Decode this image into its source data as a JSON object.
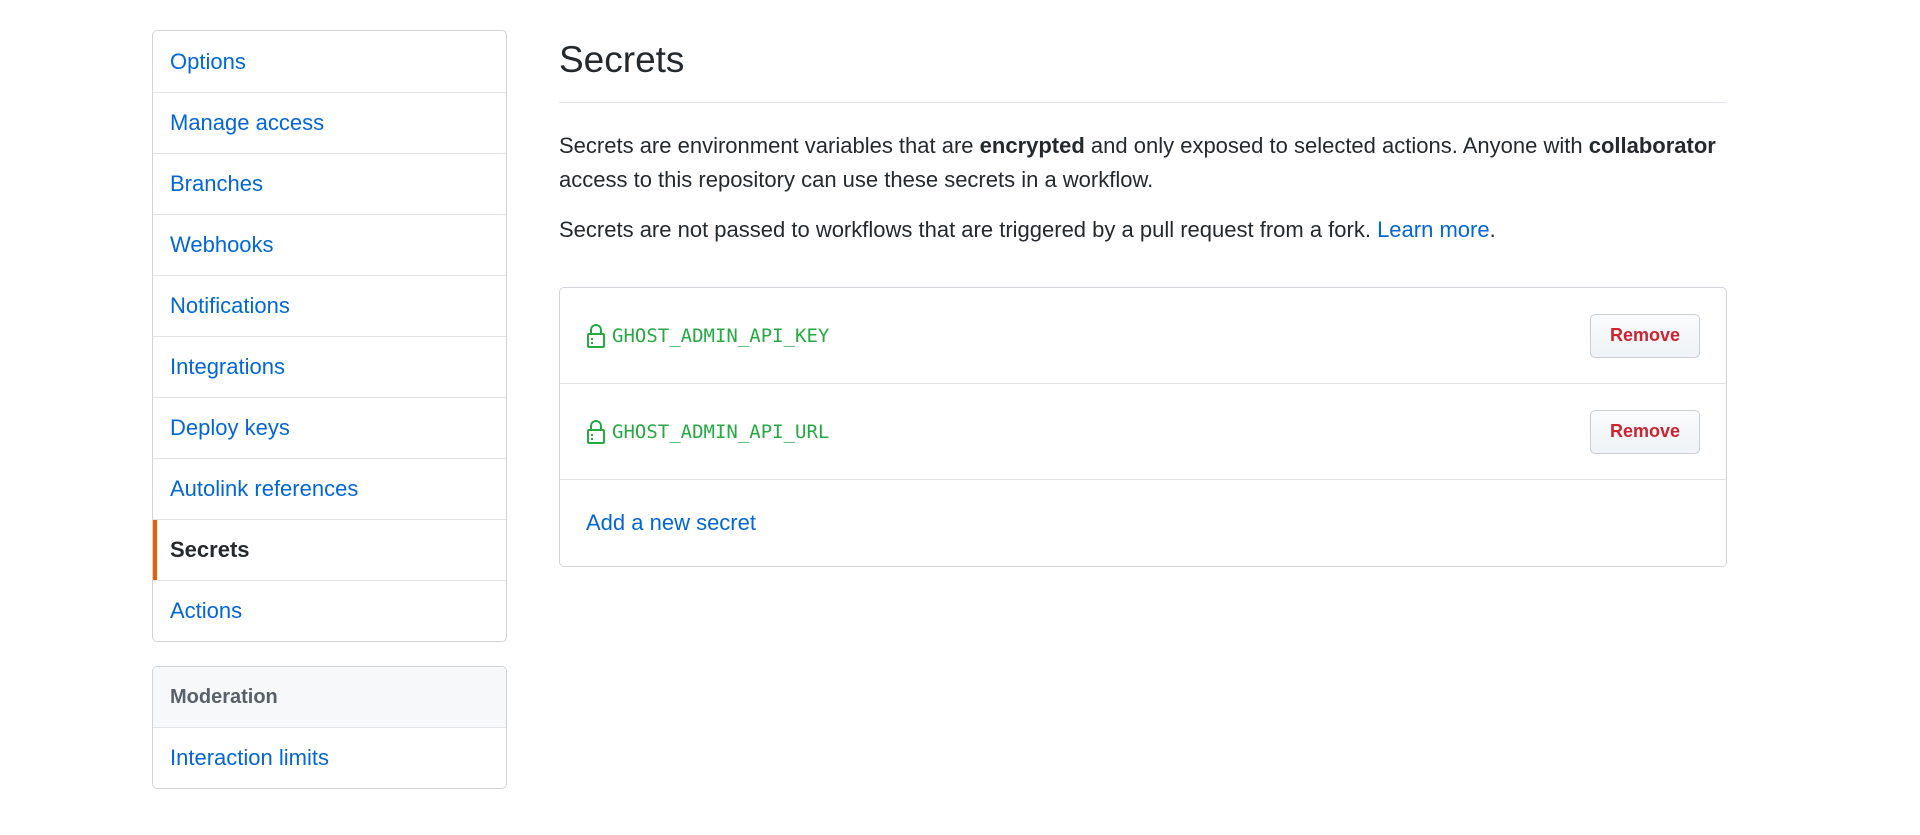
{
  "sidebar": {
    "items": [
      {
        "label": "Options"
      },
      {
        "label": "Manage access"
      },
      {
        "label": "Branches"
      },
      {
        "label": "Webhooks"
      },
      {
        "label": "Notifications"
      },
      {
        "label": "Integrations"
      },
      {
        "label": "Deploy keys"
      },
      {
        "label": "Autolink references"
      },
      {
        "label": "Secrets",
        "selected": true
      },
      {
        "label": "Actions"
      }
    ],
    "moderation": {
      "heading": "Moderation",
      "items": [
        {
          "label": "Interaction limits"
        }
      ]
    },
    "selected_accent": "#e36209"
  },
  "main": {
    "title": "Secrets",
    "description_1": {
      "part1": "Secrets are environment variables that are ",
      "bold1": "encrypted",
      "part2": " and only exposed to selected actions. Anyone with ",
      "bold2": "collaborator",
      "part3": " access to this repository can use these secrets in a workflow."
    },
    "description_2": {
      "text": "Secrets are not passed to workflows that are triggered by a pull request from a fork. ",
      "link": "Learn more",
      "end": "."
    },
    "secrets": [
      {
        "name": "GHOST_ADMIN_API_KEY",
        "icon": "lock-icon",
        "remove_label": "Remove"
      },
      {
        "name": "GHOST_ADMIN_API_URL",
        "icon": "lock-icon",
        "remove_label": "Remove"
      }
    ],
    "add_secret_label": "Add a new secret"
  },
  "colors": {
    "link": "#0366d6",
    "secret": "#28a745",
    "danger": "#cb2431"
  }
}
